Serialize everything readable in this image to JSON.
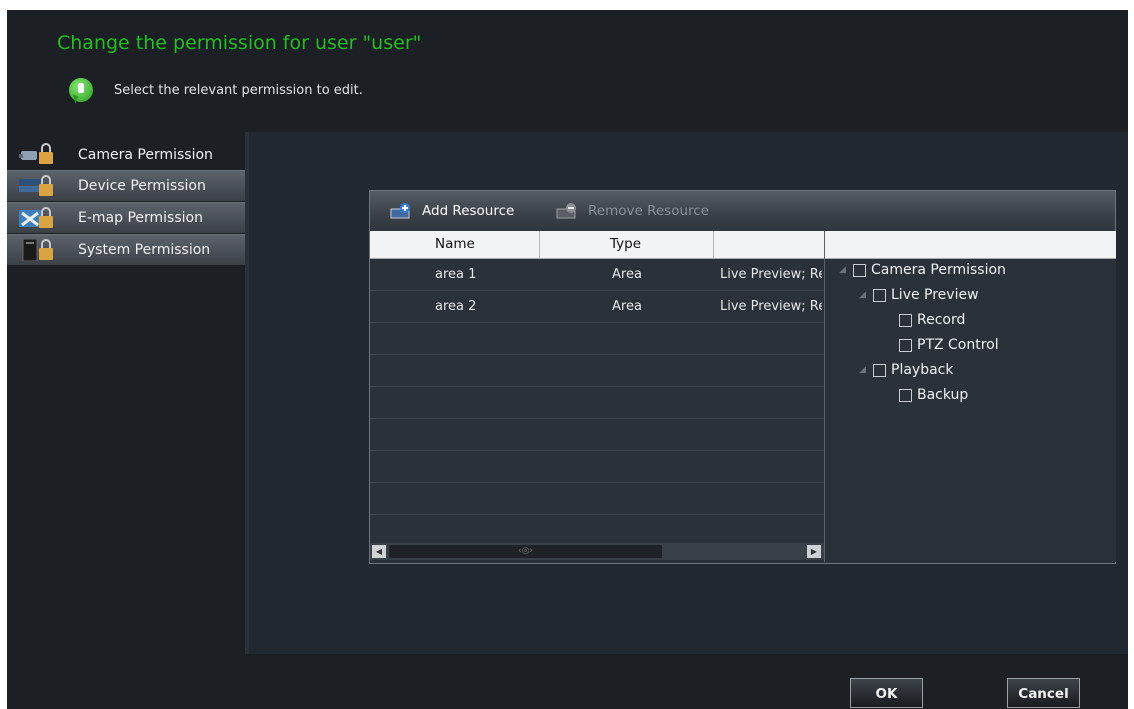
{
  "header": {
    "title": "Change the permission for user \"user\"",
    "hint": "Select the relevant permission to edit."
  },
  "sidebar": {
    "items": [
      {
        "label": "Camera Permission",
        "icon": "camera-lock-icon",
        "selected": true
      },
      {
        "label": "Device Permission",
        "icon": "device-lock-icon",
        "selected": false
      },
      {
        "label": "E-map Permission",
        "icon": "emap-lock-icon",
        "selected": false
      },
      {
        "label": "System Permission",
        "icon": "system-lock-icon",
        "selected": false
      }
    ]
  },
  "toolbar": {
    "add_label": "Add Resource",
    "remove_label": "Remove Resource",
    "remove_enabled": false
  },
  "table": {
    "columns": [
      "Name",
      "Type",
      ""
    ],
    "rows": [
      {
        "name": "area 1",
        "type": "Area",
        "permission": "Live Preview; Record; PTZ Control; Playback; Backup"
      },
      {
        "name": "area 2",
        "type": "Area",
        "permission": "Live Preview; Record; PTZ Control; Playback; Backup"
      }
    ]
  },
  "tree": {
    "nodes": [
      {
        "label": "Camera Permission",
        "checked": false,
        "expanded": true
      },
      {
        "label": "Live Preview",
        "checked": false,
        "expanded": true
      },
      {
        "label": "Record",
        "checked": false
      },
      {
        "label": "PTZ Control",
        "checked": false
      },
      {
        "label": "Playback",
        "checked": false,
        "expanded": true
      },
      {
        "label": "Backup",
        "checked": false
      }
    ]
  },
  "footer": {
    "ok_label": "OK",
    "cancel_label": "Cancel"
  },
  "colors": {
    "title": "#1fc01f",
    "background": "#222830",
    "header": "#1c1f24"
  }
}
